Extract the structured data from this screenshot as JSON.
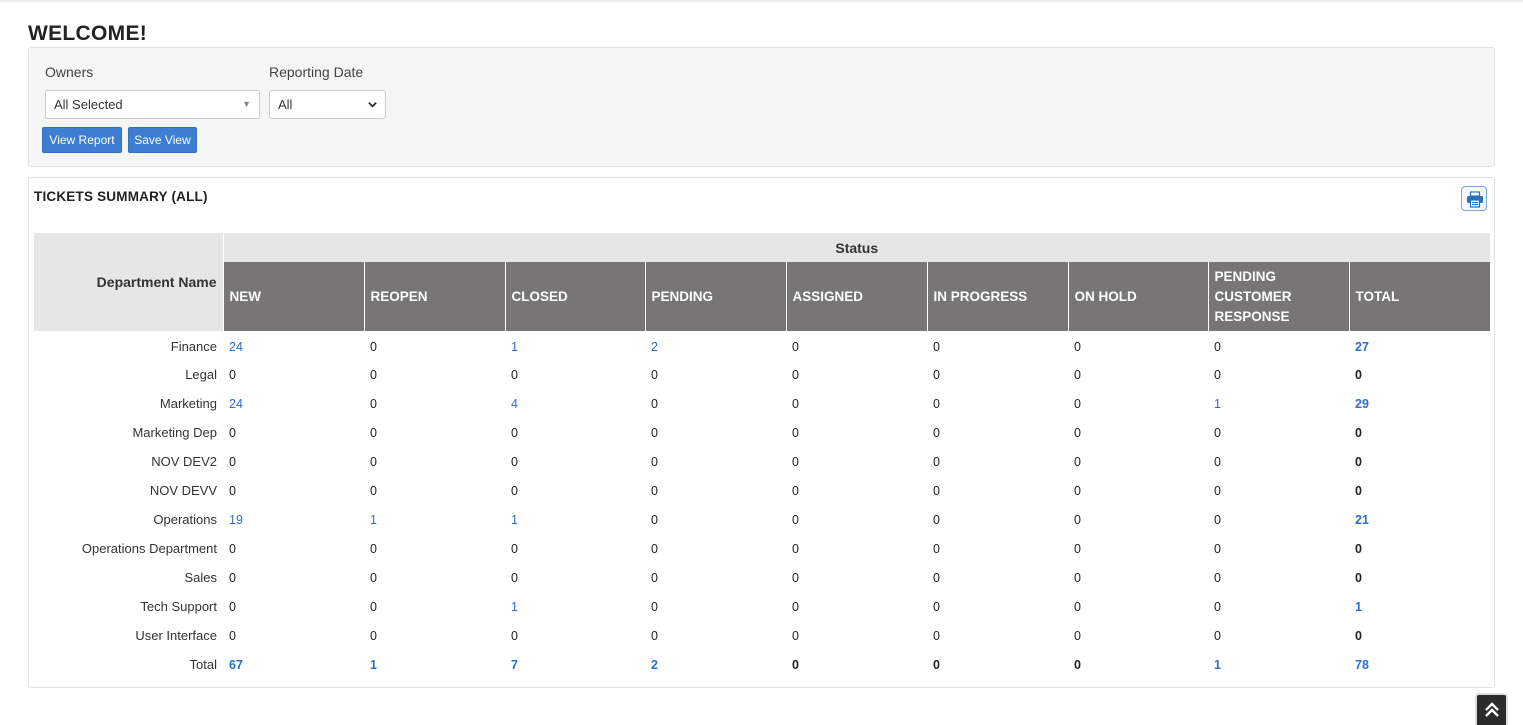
{
  "page": {
    "welcome": "WELCOME!"
  },
  "filters": {
    "owners_label": "Owners",
    "owners_value": "All Selected",
    "reporting_date_label": "Reporting Date",
    "reporting_date_value": "All",
    "view_report_label": "View Report",
    "save_view_label": "Save View"
  },
  "summary": {
    "title": "TICKETS SUMMARY  (ALL)",
    "dept_header": "Department Name",
    "status_header": "Status",
    "columns": [
      "NEW",
      "REOPEN",
      "CLOSED",
      "PENDING",
      "ASSIGNED",
      "IN PROGRESS",
      "ON HOLD",
      "PENDING CUSTOMER RESPONSE",
      "TOTAL"
    ],
    "rows": [
      {
        "name": "Finance",
        "values": [
          "24",
          "0",
          "1",
          "2",
          "0",
          "0",
          "0",
          "0",
          "27"
        ]
      },
      {
        "name": "Legal",
        "values": [
          "0",
          "0",
          "0",
          "0",
          "0",
          "0",
          "0",
          "0",
          "0"
        ]
      },
      {
        "name": "Marketing",
        "values": [
          "24",
          "0",
          "4",
          "0",
          "0",
          "0",
          "0",
          "1",
          "29"
        ]
      },
      {
        "name": "Marketing Dep",
        "values": [
          "0",
          "0",
          "0",
          "0",
          "0",
          "0",
          "0",
          "0",
          "0"
        ]
      },
      {
        "name": "NOV DEV2",
        "values": [
          "0",
          "0",
          "0",
          "0",
          "0",
          "0",
          "0",
          "0",
          "0"
        ]
      },
      {
        "name": "NOV DEVV",
        "values": [
          "0",
          "0",
          "0",
          "0",
          "0",
          "0",
          "0",
          "0",
          "0"
        ]
      },
      {
        "name": "Operations",
        "values": [
          "19",
          "1",
          "1",
          "0",
          "0",
          "0",
          "0",
          "0",
          "21"
        ]
      },
      {
        "name": "Operations Department",
        "values": [
          "0",
          "0",
          "0",
          "0",
          "0",
          "0",
          "0",
          "0",
          "0"
        ]
      },
      {
        "name": "Sales",
        "values": [
          "0",
          "0",
          "0",
          "0",
          "0",
          "0",
          "0",
          "0",
          "0"
        ]
      },
      {
        "name": "Tech Support",
        "values": [
          "0",
          "0",
          "1",
          "0",
          "0",
          "0",
          "0",
          "0",
          "1"
        ]
      },
      {
        "name": "User Interface",
        "values": [
          "0",
          "0",
          "0",
          "0",
          "0",
          "0",
          "0",
          "0",
          "0"
        ]
      }
    ],
    "total": {
      "name": "Total",
      "values": [
        "67",
        "1",
        "7",
        "2",
        "0",
        "0",
        "0",
        "1",
        "78"
      ]
    }
  },
  "icons": {
    "print": "printer-icon",
    "scroll_top": "double-chevron-up-icon"
  },
  "colors": {
    "accent": "#3d7ed3",
    "link": "#2a6ed0",
    "header_dark": "#777575",
    "header_light": "#e6e6e6"
  }
}
